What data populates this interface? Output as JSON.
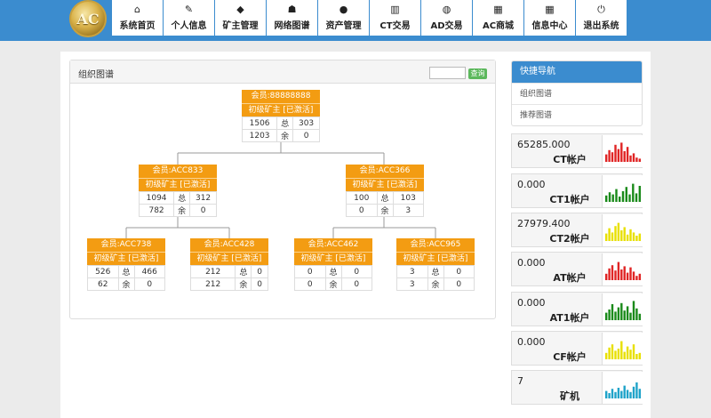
{
  "logo": {
    "text": "AC"
  },
  "nav": [
    {
      "icon": "home-icon",
      "glyph": "⌂",
      "label": "系统首页"
    },
    {
      "icon": "edit-icon",
      "glyph": "✎",
      "label": "个人信息"
    },
    {
      "icon": "diamond-icon",
      "glyph": "◆",
      "label": "矿主管理"
    },
    {
      "icon": "users-icon",
      "glyph": "☗",
      "label": "网络图谱"
    },
    {
      "icon": "user-icon",
      "glyph": "●",
      "label": "资产管理"
    },
    {
      "icon": "bar-chart-icon",
      "glyph": "▥",
      "label": "CT交易"
    },
    {
      "icon": "dashboard-icon",
      "glyph": "◍",
      "label": "AD交易"
    },
    {
      "icon": "calendar-icon",
      "glyph": "▦",
      "label": "AC商城"
    },
    {
      "icon": "calendar-icon",
      "glyph": "▦",
      "label": "信息中心"
    },
    {
      "icon": "power-icon",
      "glyph": "⏻",
      "label": "退出系统"
    }
  ],
  "org": {
    "title": "组织图谱",
    "search_value": "",
    "query_label": "查询"
  },
  "tree": [
    {
      "account": "会员:88888888",
      "level": "初级矿主 [已激活]",
      "total_left": "1506",
      "total_label": "总",
      "total_right": "303",
      "rem_left": "1203",
      "rem_label": "余",
      "rem_right": "0"
    },
    {
      "account": "会员:ACC833",
      "level": "初级矿主 [已激活]",
      "total_left": "1094",
      "total_label": "总",
      "total_right": "312",
      "rem_left": "782",
      "rem_label": "余",
      "rem_right": "0"
    },
    {
      "account": "会员:ACC366",
      "level": "初级矿主 [已激活]",
      "total_left": "100",
      "total_label": "总",
      "total_right": "103",
      "rem_left": "0",
      "rem_label": "余",
      "rem_right": "3"
    },
    {
      "account": "会员:ACC738",
      "level": "初级矿主 [已激活]",
      "total_left": "526",
      "total_label": "总",
      "total_right": "466",
      "rem_left": "62",
      "rem_label": "余",
      "rem_right": "0"
    },
    {
      "account": "会员:ACC428",
      "level": "初级矿主 [已激活]",
      "total_left": "212",
      "total_label": "总",
      "total_right": "0",
      "rem_left": "212",
      "rem_label": "余",
      "rem_right": "0"
    },
    {
      "account": "会员:ACC462",
      "level": "初级矿主 [已激活]",
      "total_left": "0",
      "total_label": "总",
      "total_right": "0",
      "rem_left": "0",
      "rem_label": "余",
      "rem_right": "0"
    },
    {
      "account": "会员:ACC965",
      "level": "初级矿主 [已激活]",
      "total_left": "3",
      "total_label": "总",
      "total_right": "0",
      "rem_left": "3",
      "rem_label": "余",
      "rem_right": "0"
    }
  ],
  "sidebar": {
    "title": "快捷导航",
    "links": [
      "组织图谱",
      "推荐图谱"
    ]
  },
  "accounts": [
    {
      "value": "65285.000",
      "name": "CT帐户",
      "color": "#e02424",
      "bars": [
        0.35,
        0.55,
        0.45,
        0.8,
        0.6,
        0.9,
        0.5,
        0.7,
        0.3,
        0.4,
        0.2,
        0.15
      ]
    },
    {
      "value": "0.000",
      "name": "CT1帐户",
      "color": "#1a8a1a",
      "bars": [
        0.3,
        0.45,
        0.35,
        0.6,
        0.25,
        0.5,
        0.7,
        0.35,
        0.85,
        0.4,
        0.75
      ]
    },
    {
      "value": "27979.400",
      "name": "CT2帐户",
      "color": "#e8e000",
      "bars": [
        0.35,
        0.6,
        0.4,
        0.7,
        0.85,
        0.5,
        0.65,
        0.3,
        0.55,
        0.4,
        0.25,
        0.35
      ]
    },
    {
      "value": "0.000",
      "name": "AT帐户",
      "color": "#e02424",
      "bars": [
        0.3,
        0.55,
        0.7,
        0.45,
        0.85,
        0.5,
        0.65,
        0.35,
        0.6,
        0.4,
        0.2,
        0.3
      ]
    },
    {
      "value": "0.000",
      "name": "AT1帐户",
      "color": "#1a8a1a",
      "bars": [
        0.35,
        0.5,
        0.75,
        0.4,
        0.6,
        0.8,
        0.45,
        0.65,
        0.35,
        0.9,
        0.55,
        0.3
      ]
    },
    {
      "value": "0.000",
      "name": "CF帐户",
      "color": "#e8e000",
      "bars": [
        0.3,
        0.55,
        0.7,
        0.4,
        0.5,
        0.85,
        0.35,
        0.6,
        0.45,
        0.7,
        0.25,
        0.3
      ]
    },
    {
      "value": "7",
      "name": "矿机",
      "color": "#1fa3c9",
      "bars": [
        0.35,
        0.25,
        0.45,
        0.3,
        0.5,
        0.35,
        0.6,
        0.4,
        0.3,
        0.55,
        0.75,
        0.45
      ]
    }
  ]
}
